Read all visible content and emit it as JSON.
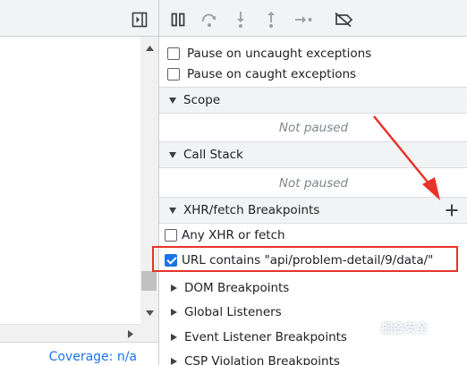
{
  "debugger": {
    "pause_on_uncaught_label": "Pause on uncaught exceptions",
    "pause_on_caught_label": "Pause on caught exceptions",
    "sections": {
      "scope": {
        "title": "Scope",
        "status": "Not paused"
      },
      "call_stack": {
        "title": "Call Stack",
        "status": "Not paused"
      },
      "xhr_fetch": {
        "title": "XHR/fetch Breakpoints",
        "items": [
          {
            "label": "Any XHR or fetch",
            "checked": false
          },
          {
            "label": "URL contains \"api/problem-detail/9/data/\"",
            "checked": true
          }
        ]
      },
      "collapsed": [
        "DOM Breakpoints",
        "Global Listeners",
        "Event Listener Breakpoints",
        "CSP Violation Breakpoints"
      ]
    }
  },
  "left_panel": {
    "coverage_text": "Coverage: n/a"
  },
  "watermark": "掘金安全",
  "icons": [
    "toggle-navigator-icon",
    "pause-icon",
    "step-over-icon",
    "step-into-icon",
    "step-out-icon",
    "step-icon",
    "deactivate-breakpoints-icon",
    "add-icon",
    "scroll-up-icon",
    "scroll-down-icon",
    "scroll-right-icon"
  ],
  "colors": {
    "accent": "#1a73e8",
    "annotation": "#e8332a",
    "toolbar": "#f1f3f4"
  }
}
